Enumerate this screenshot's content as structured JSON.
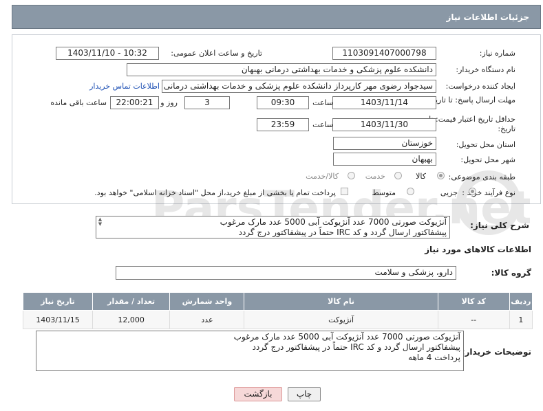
{
  "header": {
    "title": "جزئیات اطلاعات نیاز"
  },
  "need_number": {
    "label": "شماره نیاز:",
    "value": "1103091407000798"
  },
  "announce_datetime": {
    "label": "تاریخ و ساعت اعلان عمومی:",
    "value": "1403/11/10 - 10:32"
  },
  "buyer_org": {
    "label": "نام دستگاه خریدار:",
    "value": "دانشکده علوم پزشکی و خدمات بهداشتی  درمانی بهبهان"
  },
  "requester": {
    "label": "ایجاد کننده درخواست:",
    "value": "سیدجواد رضوی مهر کارپرداز دانشکده علوم پزشکی و خدمات بهداشتی  درمانی",
    "contact_link": "اطلاعات تماس خریدار"
  },
  "reply_deadline": {
    "label": "مهلت ارسال پاسخ: تا تاریخ:",
    "date": "1403/11/14",
    "time_label": "ساعت",
    "time": "09:30",
    "days": "3",
    "days_label": "روز و",
    "remaining": "22:00:21",
    "remaining_label": "ساعت باقی مانده"
  },
  "price_validity": {
    "label": "حداقل تاریخ اعتبار قیمت: تا تاریخ:",
    "date": "1403/11/30",
    "time_label": "ساعت",
    "time": "23:59"
  },
  "province": {
    "label": "استان محل تحویل:",
    "value": "خوزستان"
  },
  "city": {
    "label": "شهر محل تحویل:",
    "value": "بهبهان"
  },
  "category": {
    "label": "طبقه بندی موضوعی:",
    "options": [
      "کالا",
      "خدمت",
      "کالا/خدمت"
    ],
    "selected": 0
  },
  "process_type": {
    "label": "نوع فرآیند خرید :",
    "options": [
      "جزیی",
      "متوسط"
    ],
    "selected": 0,
    "note": "پرداخت تمام یا بخشی از مبلغ خرید،از محل \"اسناد خزانه اسلامی\" خواهد بود."
  },
  "need_summary": {
    "label": "شرح کلی نیاز:",
    "line1": "آنژیوکت صورتی 7000 عدد آنژیوکت آبی 5000 عدد مارک مرغوب",
    "line2": "پیشفاکتور ارسال گردد و کد IRC حتماً در پیشفاکتور درج گردد"
  },
  "goods_info": {
    "title": "اطلاعات کالاهای مورد نیاز",
    "group_label": "گروه کالا:",
    "group_value": "دارو، پزشکی و سلامت"
  },
  "table": {
    "headers": [
      "ردیف",
      "کد کالا",
      "نام کالا",
      "واحد شمارش",
      "تعداد / مقدار",
      "تاریخ نیاز"
    ],
    "rows": [
      [
        "1",
        "--",
        "آنژیوکت",
        "عدد",
        "12,000",
        "1403/11/15"
      ]
    ]
  },
  "buyer_notes": {
    "label": "توضیحات خریدار:",
    "line1": "آنژیوکت صورتی 7000 عدد آنژیوکت آبی 5000 عدد مارک مرغوب",
    "line2": "پیشفاکتور ارسال گردد و کد IRC حتماً در پیشفاکتور درج گردد",
    "line3": "پرداخت 4 ماهه"
  },
  "buttons": {
    "print": "چاپ",
    "back": "بازگشت"
  },
  "watermark": "ParsTender.net"
}
